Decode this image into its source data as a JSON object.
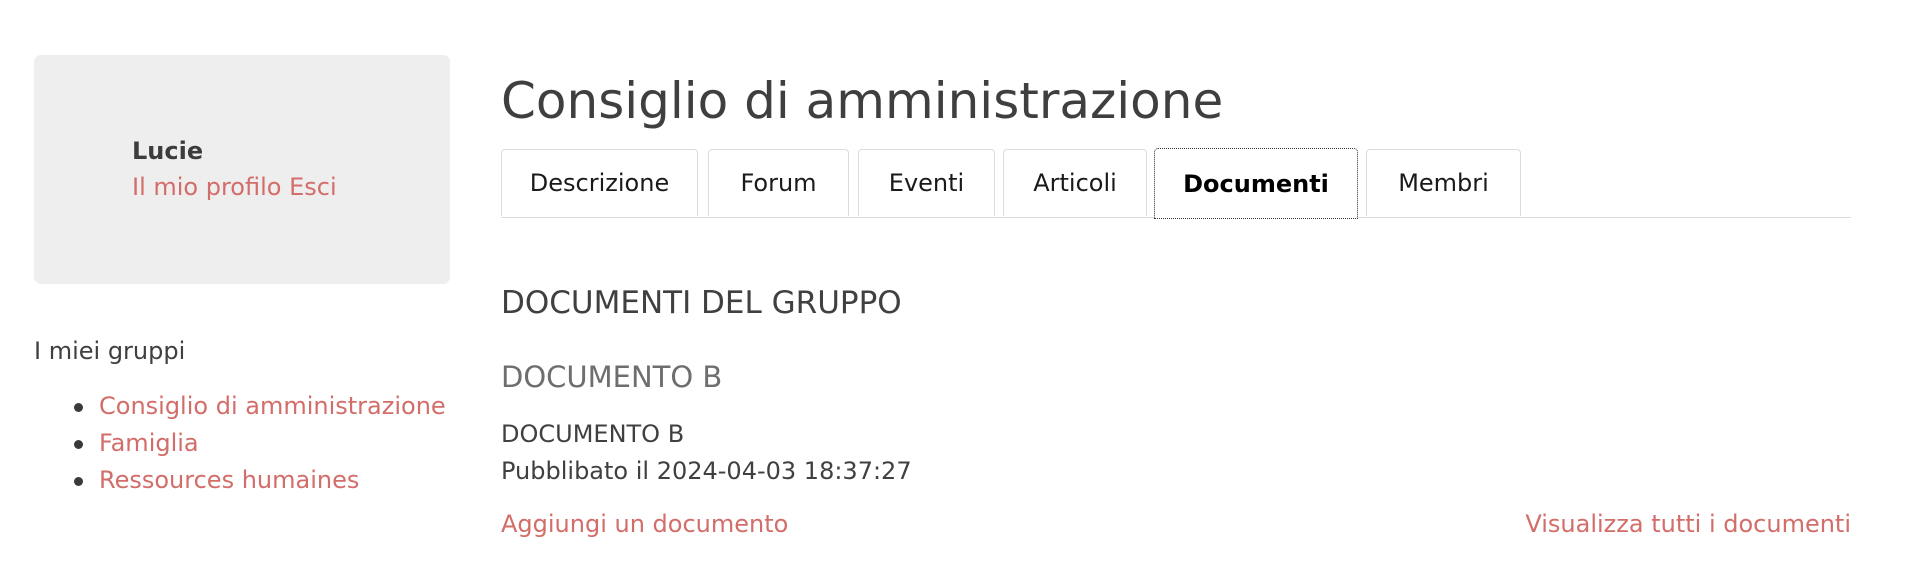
{
  "sidebar": {
    "user_name": "Lucie",
    "profile_link": "Il mio profilo",
    "logout_link": "Esci",
    "groups_title": "I miei gruppi",
    "groups": [
      {
        "label": "Consiglio di amministrazione"
      },
      {
        "label": "Famiglia"
      },
      {
        "label": "Ressources humaines"
      }
    ]
  },
  "main": {
    "title": "Consiglio di amministrazione",
    "tabs": [
      {
        "label": "Descrizione",
        "active": false
      },
      {
        "label": "Forum",
        "active": false
      },
      {
        "label": "Eventi",
        "active": false
      },
      {
        "label": "Articoli",
        "active": false
      },
      {
        "label": "Documenti",
        "active": true
      },
      {
        "label": "Membri",
        "active": false
      }
    ],
    "section_title": "DOCUMENTI DEL GRUPPO",
    "document": {
      "title": "DOCUMENTO B",
      "name": "DOCUMENTO B",
      "published": "Pubblibato il 2024-04-03 18:37:27"
    },
    "add_document_link": "Aggiungi un documento",
    "view_all_link": "Visualizza tutti i documenti"
  },
  "colors": {
    "link": "#d26d69",
    "profile_box_bg": "#eeeeee",
    "text": "#404040"
  }
}
